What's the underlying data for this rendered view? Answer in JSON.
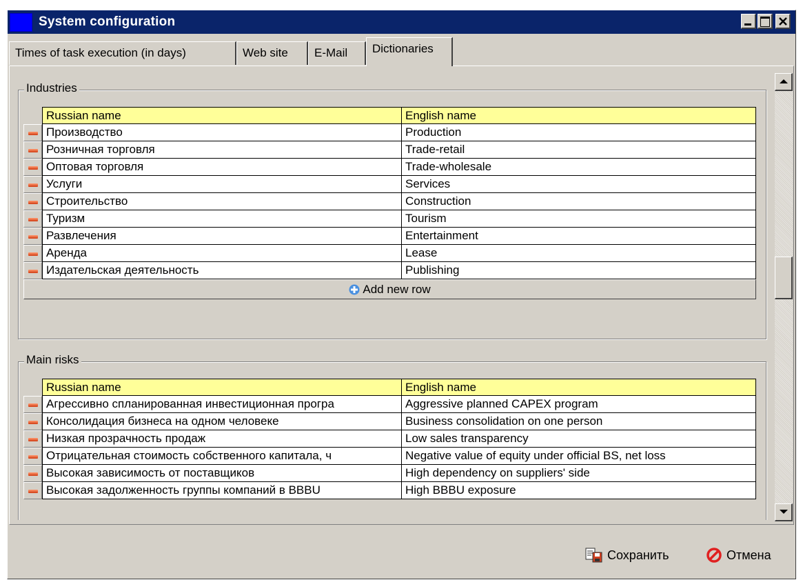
{
  "window": {
    "title": "System configuration"
  },
  "tabs": [
    {
      "label": "Times of task execution (in days)"
    },
    {
      "label": "Web site"
    },
    {
      "label": "E-Mail"
    },
    {
      "label": "Dictionaries",
      "active": true
    }
  ],
  "industries": {
    "title": "Industries",
    "columns": [
      "Russian name",
      "English name"
    ],
    "rows": [
      [
        "Производство",
        "Production"
      ],
      [
        "Розничная торговля",
        "Trade-retail"
      ],
      [
        "Оптовая торговля",
        "Trade-wholesale"
      ],
      [
        "Услуги",
        "Services"
      ],
      [
        "Строительство",
        "Construction"
      ],
      [
        "Туризм",
        "Tourism"
      ],
      [
        "Развлечения",
        "Entertainment"
      ],
      [
        "Аренда",
        "Lease"
      ],
      [
        "Издательская деятельность",
        "Publishing"
      ]
    ],
    "add_label": "Add new row"
  },
  "risks": {
    "title": "Main risks",
    "columns": [
      "Russian name",
      "English name"
    ],
    "rows": [
      [
        "Агрессивно спланированная инвестиционная програ",
        "Aggressive planned CAPEX program"
      ],
      [
        "Консолидация бизнеса  на одном человеке",
        "Business consolidation on one person"
      ],
      [
        "Низкая  прозрачность продаж",
        "Low sales transparency"
      ],
      [
        "Отрицательная стоимость собственного капитала, ч",
        "Negative value of equity under official BS, net loss"
      ],
      [
        "Высокая зависимость от поставщиков",
        "High dependency on suppliers' side"
      ],
      [
        "Высокая  задолженность группы компаний в BBBU",
        "High BBBU exposure"
      ]
    ]
  },
  "buttons": {
    "save": "Сохранить",
    "cancel": "Отмена"
  },
  "colors": {
    "title_bar": "#0a246a",
    "header_row": "#ffff99",
    "face": "#d4d0c8",
    "delete_icon": "#e05020",
    "cancel_icon": "#e02020"
  }
}
